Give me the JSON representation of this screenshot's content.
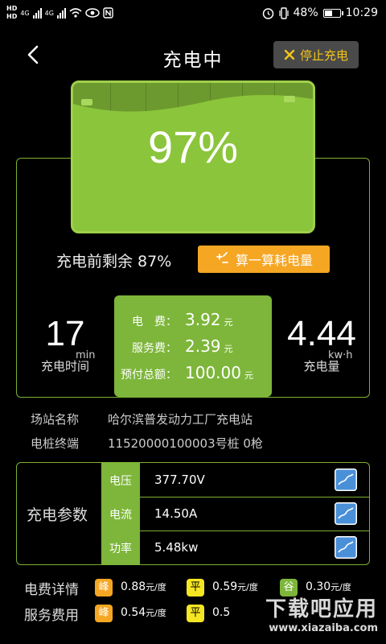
{
  "status_bar": {
    "network_left_top": "HD",
    "network_left_bottom": "HD",
    "net1": "4G",
    "net2": "4G",
    "battery_pct": "48%",
    "battery_level": 0.48,
    "time": "10:29",
    "icons": [
      "signal-icon",
      "wifi-icon",
      "eye-icon",
      "nfc-icon",
      "alarm-icon",
      "vibrate-icon",
      "battery-icon"
    ]
  },
  "header": {
    "title": "充电中",
    "stop_label": "停止充电"
  },
  "battery": {
    "percent": "97%",
    "color": "#8bc53b"
  },
  "remain": {
    "label": "充电前剩余 87%",
    "calc_label": "算一算耗电量"
  },
  "stats": {
    "time_value": "17",
    "time_unit": "min",
    "time_label": "充电时间",
    "energy_value": "4.44",
    "energy_unit": "kw·h",
    "energy_label": "充电量"
  },
  "fees": {
    "rows": [
      {
        "key": "电　费：",
        "value": "3.92",
        "unit": "元"
      },
      {
        "key": "服务费：",
        "value": "2.39",
        "unit": "元"
      },
      {
        "key": "预付总额：",
        "value": "100.00",
        "unit": "元"
      }
    ]
  },
  "station": {
    "name_label": "场站名称",
    "name_value": "哈尔滨普发动力工厂充电站",
    "terminal_label": "电桩终端",
    "terminal_value": "11520000100003号桩 0枪"
  },
  "params": {
    "title": "充电参数",
    "rows": [
      {
        "key": "电压",
        "value": "377.70V"
      },
      {
        "key": "电流",
        "value": "14.50A"
      },
      {
        "key": "功率",
        "value": "5.48kw"
      }
    ]
  },
  "tariff": {
    "electric_label": "电费详情",
    "service_label": "服务费用",
    "unit": "元/度",
    "electric": [
      {
        "tag": "峰",
        "value": "0.88"
      },
      {
        "tag": "平",
        "value": "0.59"
      },
      {
        "tag": "谷",
        "value": "0.30"
      }
    ],
    "service": [
      {
        "tag": "峰",
        "value": "0.54"
      },
      {
        "tag": "平",
        "value": "0.5"
      }
    ],
    "colors": {
      "peak": "#f5a623",
      "flat": "#f5e623",
      "valley": "#7db63a"
    }
  },
  "watermark": {
    "main": "下载吧应用",
    "sub": "www.xiazaiba.com"
  }
}
